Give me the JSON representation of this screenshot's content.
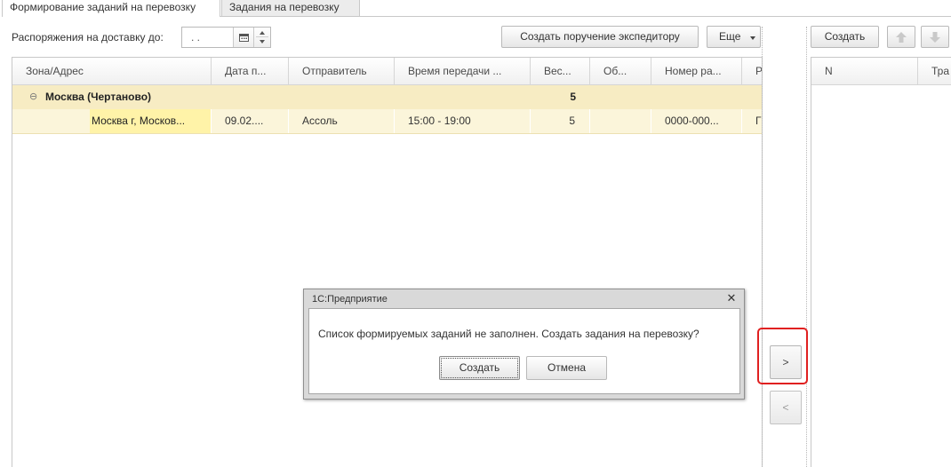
{
  "tabs": {
    "active": "Формирование заданий на перевозку",
    "inactive": "Задания на перевозку"
  },
  "filter": {
    "label": "Распоряжения на доставку до:",
    "date_value": " .  ."
  },
  "toolbar_left": {
    "create_courier_order": "Создать поручение экспедитору",
    "more": "Еще"
  },
  "toolbar_right": {
    "create": "Создать"
  },
  "left_table": {
    "columns": [
      "Зона/Адрес",
      "Дата п...",
      "Отправитель",
      "Время передачи ...",
      "Вес...",
      "Об...",
      "Номер ра...",
      "Р"
    ],
    "group_row": {
      "toggle": "⊖",
      "label": "Москва (Чертаново)",
      "weight": "5"
    },
    "data_row": {
      "address": "Москва г, Москов...",
      "date": "09.02....",
      "sender": "Ассоль",
      "time": "15:00 - 19:00",
      "weight": "5",
      "volume": "",
      "number": "0000-000...",
      "extra": "Г"
    }
  },
  "right_table": {
    "columns": [
      "N",
      "Тра"
    ]
  },
  "transfer": {
    "move_right": ">",
    "move_left": "<"
  },
  "dialog": {
    "title": "1С:Предприятие",
    "close": "✕",
    "message": "Список формируемых заданий не заполнен. Создать задания на перевозку?",
    "ok_label": "Создать",
    "cancel_label": "Отмена"
  },
  "colors": {
    "group_row": "#f7ecc3",
    "selected_row": "#fbf5da",
    "selected_cell": "#fff3a8",
    "highlight": "#e02020"
  }
}
